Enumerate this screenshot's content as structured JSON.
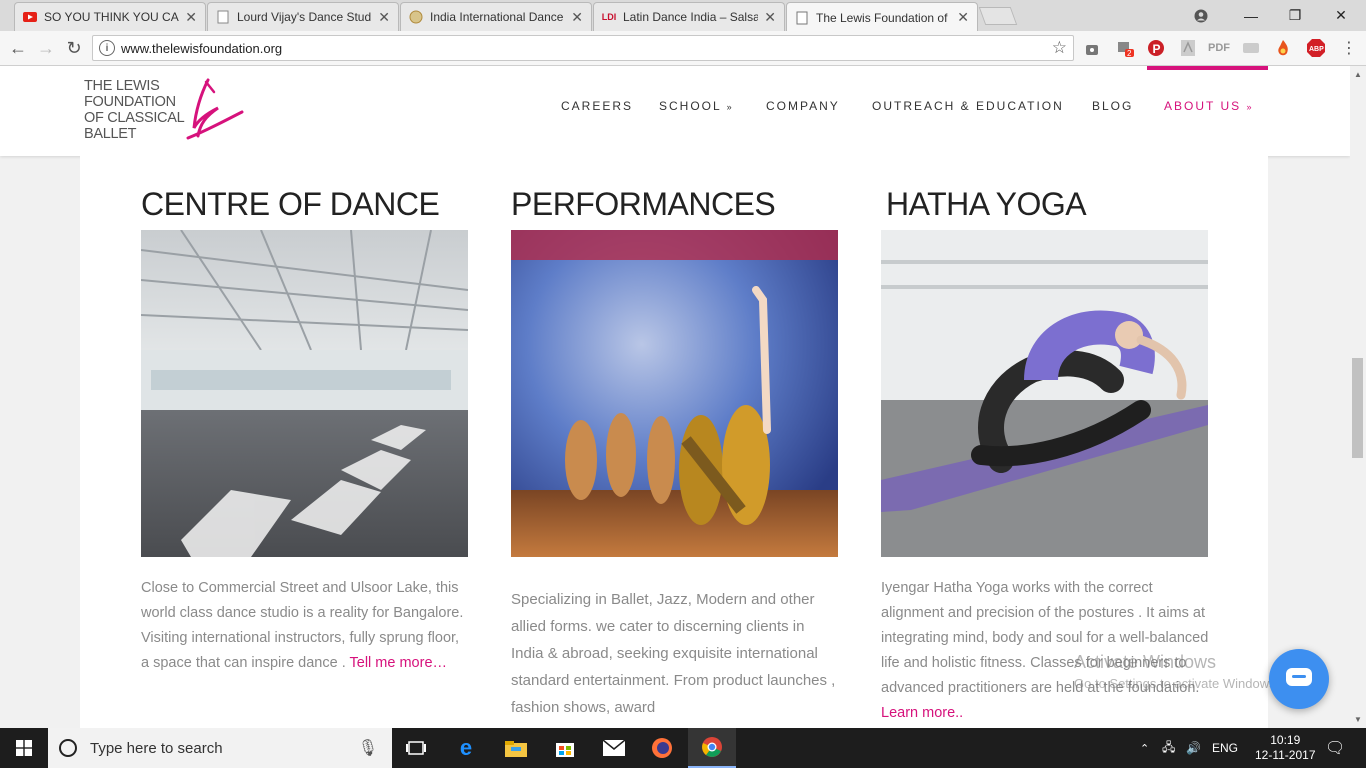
{
  "browser": {
    "tabs": [
      {
        "title": "SO YOU THINK YOU CAN",
        "favicon": "youtube-icon",
        "color": "#e62117"
      },
      {
        "title": "Lourd Vijay's Dance Stud",
        "favicon": "page-icon",
        "color": "#888888"
      },
      {
        "title": "India International Dance",
        "favicon": "site-icon",
        "color": "#b08a3c"
      },
      {
        "title": "Latin Dance India – Salsa",
        "favicon": "ldi-icon",
        "color": "#c8102e"
      },
      {
        "title": "The Lewis Foundation of",
        "favicon": "page-icon",
        "color": "#777777"
      }
    ],
    "url": "www.thelewisfoundation.org",
    "ext_badge": "2",
    "abp_label": "ABP",
    "pdf_label": "PDF"
  },
  "site": {
    "logo_lines": [
      "THE LEWIS",
      "FOUNDATION",
      "OF CLASSICAL",
      "BALLET"
    ],
    "nav": [
      {
        "label": "CAREERS",
        "dropdown": false
      },
      {
        "label": "SCHOOL",
        "dropdown": true
      },
      {
        "label": "COMPANY",
        "dropdown": false
      },
      {
        "label": "OUTREACH & EDUCATION",
        "dropdown": false
      },
      {
        "label": "BLOG",
        "dropdown": false
      },
      {
        "label": "ABOUT US",
        "dropdown": true
      }
    ],
    "accent_color": "#d6127c",
    "columns": [
      {
        "title": "CENTRE OF DANCE",
        "text": "Close to Commercial Street and Ulsoor Lake, this world class dance studio is a reality for Bangalore. Visiting international instructors, fully sprung floor, a space that can inspire dance . ",
        "link": "Tell me more…"
      },
      {
        "title": "PERFORMANCES",
        "text": "Specializing in Ballet, Jazz, Modern and other allied forms. we cater to discerning clients in India & abroad, seeking exquisite international standard entertainment. From product launches , fashion shows, award",
        "link": ""
      },
      {
        "title": "HATHA YOGA",
        "text": "Iyengar Hatha Yoga works with the correct alignment and precision of the postures . It aims at integrating mind, body and soul for a well-balanced life and holistic fitness. Classes for beginners to advanced practitioners are held at the foundation. ",
        "link": "Learn more.."
      }
    ]
  },
  "watermark": {
    "line1": "Activate Windows",
    "line2": "Go to Settings to activate Windows."
  },
  "taskbar": {
    "search_placeholder": "Type here to search",
    "lang": "ENG",
    "time": "10:19",
    "date": "12-11-2017"
  }
}
